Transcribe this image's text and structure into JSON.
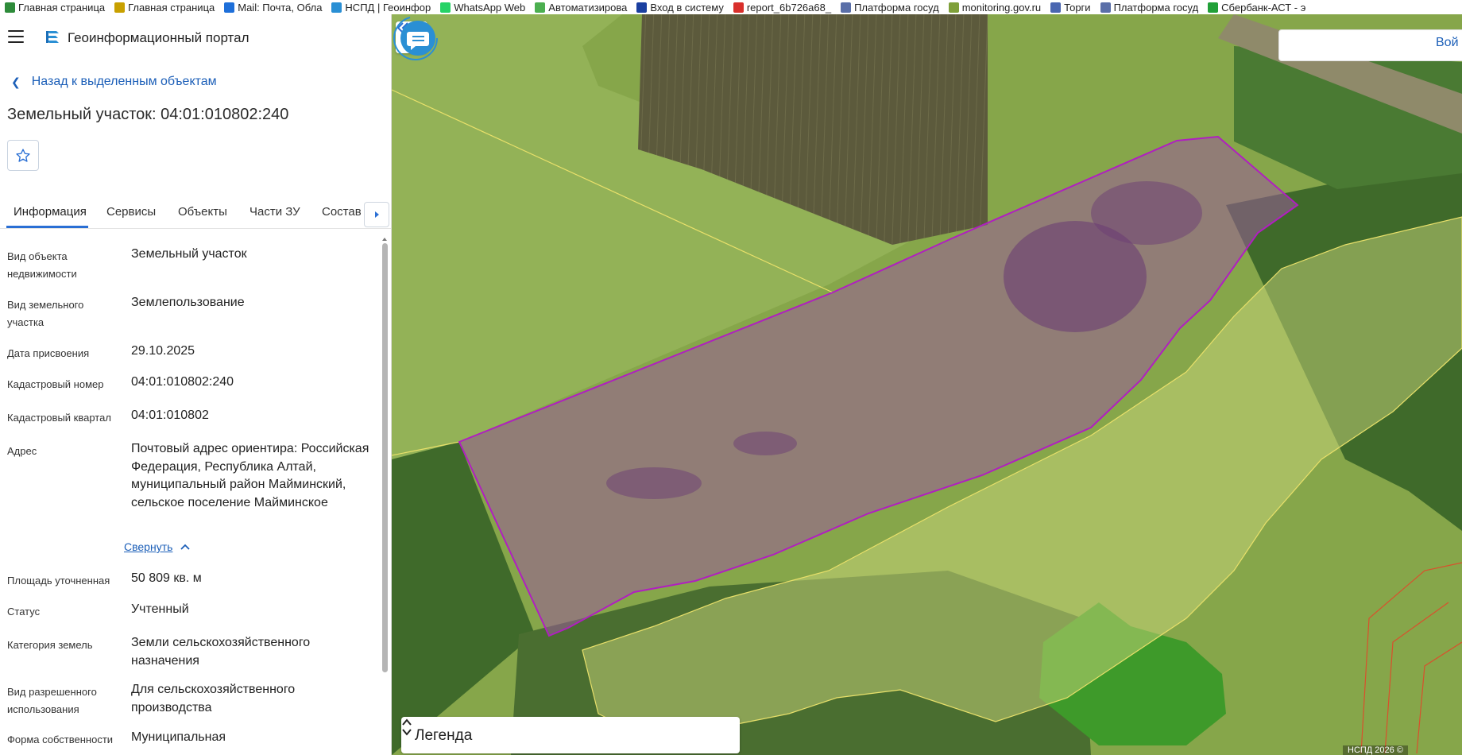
{
  "bookmarks": [
    {
      "label": "Главная страница",
      "icon": "green-check-icon",
      "color": "#2e8b3a"
    },
    {
      "label": "Главная страница",
      "icon": "eagle-emblem-icon",
      "color": "#c8a000"
    },
    {
      "label": "Mail: Почта, Обла",
      "icon": "mail-at-icon",
      "color": "#1e6fd9"
    },
    {
      "label": "НСПД | Геоинфор",
      "icon": "nspd-logo-icon",
      "color": "#2a8fd4"
    },
    {
      "label": "WhatsApp Web",
      "icon": "whatsapp-icon",
      "color": "#25d366"
    },
    {
      "label": "Автоматизирова",
      "icon": "apple-green-icon",
      "color": "#4caf50"
    },
    {
      "label": "Вход в систему",
      "icon": "blue-circle-icon",
      "color": "#1a3fa0"
    },
    {
      "label": "report_6b726a68_",
      "icon": "red-doc-icon",
      "color": "#d9302c"
    },
    {
      "label": "Платформа госуд",
      "icon": "eagle-emblem-icon",
      "color": "#5a6fa8"
    },
    {
      "label": "monitoring.gov.ru",
      "icon": "chart-icon",
      "color": "#7fa03a"
    },
    {
      "label": "Торги",
      "icon": "eagle-emblem-icon",
      "color": "#4a66b0"
    },
    {
      "label": "Платформа госуд",
      "icon": "eagle-emblem-icon",
      "color": "#5a6fa8"
    },
    {
      "label": "Сбербанк-АСТ - э",
      "icon": "sber-icon",
      "color": "#21a038"
    }
  ],
  "header": {
    "portal_title": "Геоинформационный портал"
  },
  "panel": {
    "back_label": "Назад к выделенным объектам",
    "object_title": "Земельный участок: 04:01:010802:240",
    "tabs": [
      {
        "label": "Информация"
      },
      {
        "label": "Сервисы"
      },
      {
        "label": "Объекты"
      },
      {
        "label": "Части ЗУ"
      },
      {
        "label": "Состав"
      }
    ],
    "info": [
      {
        "label": "Вид объекта недвижимости",
        "value": "Земельный участок"
      },
      {
        "label": "Вид земельного участка",
        "value": "Землепользование"
      },
      {
        "label": "Дата присвоения",
        "value": "29.10.2025"
      },
      {
        "label": "Кадастровый номер",
        "value": "04:01:010802:240"
      },
      {
        "label": "Кадастровый квартал",
        "value": "04:01:010802"
      },
      {
        "label": "Адрес",
        "value": "Почтовый адрес ориентира: Российская Федерация, Республика Алтай, муниципальный район Майминский, сельское поселение Майминское"
      },
      {
        "label": "Площадь уточненная",
        "value": "50 809 кв. м"
      },
      {
        "label": "Статус",
        "value": "Учтенный"
      },
      {
        "label": "Категория земель",
        "value": "Земли сельскохозяйственного назначения"
      },
      {
        "label": "Вид разрешенного использования",
        "value": "Для сельскохозяйственного производства"
      },
      {
        "label": "Форма собственности",
        "value": "Муниципальная"
      }
    ],
    "collapse_label": "Свернуть"
  },
  "map": {
    "login_label": "Вой",
    "legend_label": "Легенда",
    "copyright": "НСПД 2026 ©",
    "colors": {
      "parcel_stroke": "#b01fc0",
      "parcel_fill": "#9a5b9a",
      "boundary": "#e8e06a",
      "accent": "#2a6fd4"
    }
  }
}
